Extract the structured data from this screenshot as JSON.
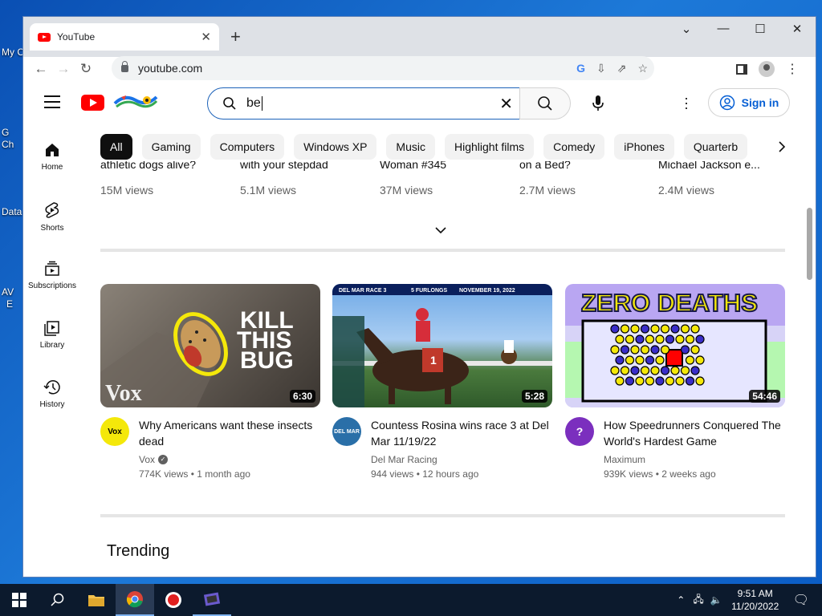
{
  "desktop": {
    "icons": [
      "My C",
      "G",
      "Ch",
      "Data",
      "AV",
      "E"
    ]
  },
  "browser": {
    "tab_title": "YouTube",
    "url": "youtube.com"
  },
  "youtube": {
    "search_value": "be",
    "sign_in": "Sign in",
    "sidebar": [
      {
        "label": "Home",
        "icon": "home-icon"
      },
      {
        "label": "Shorts",
        "icon": "shorts-icon"
      },
      {
        "label": "Subscriptions",
        "icon": "subscriptions-icon"
      },
      {
        "label": "Library",
        "icon": "library-icon"
      },
      {
        "label": "History",
        "icon": "history-icon"
      }
    ],
    "chips": [
      "All",
      "Gaming",
      "Computers",
      "Windows XP",
      "Music",
      "Highlight films",
      "Comedy",
      "iPhones",
      "Quarterb"
    ],
    "top_row": [
      {
        "title": "athletic dogs alive?",
        "views": "15M views"
      },
      {
        "title": "with your stepdad",
        "views": "5.1M views"
      },
      {
        "title": "Woman #345",
        "views": "37M views"
      },
      {
        "title": "on a Bed?",
        "views": "2.7M views"
      },
      {
        "title": "Michael Jackson e...",
        "views": "2.4M views"
      }
    ],
    "videos": [
      {
        "title": "Why Americans want these insects dead",
        "channel": "Vox",
        "verified": true,
        "stats": "774K views • 1 month ago",
        "duration": "6:30",
        "thumb_text": "KILL THIS BUG",
        "brand": "Vox"
      },
      {
        "title": "Countess Rosina wins race 3 at Del Mar 11/19/22",
        "channel": "Del Mar Racing",
        "verified": false,
        "stats": "944 views • 12 hours ago",
        "duration": "5:28",
        "thumb_text": "NOVEMBER 19, 2022"
      },
      {
        "title": "How Speedrunners Conquered The World's Hardest Game",
        "channel": "Maximum",
        "verified": false,
        "stats": "939K views • 2 weeks ago",
        "duration": "54:46",
        "thumb_text": "ZERO DEATHS"
      }
    ],
    "trending": "Trending"
  },
  "taskbar": {
    "time": "9:51 AM",
    "date": "11/20/2022"
  }
}
